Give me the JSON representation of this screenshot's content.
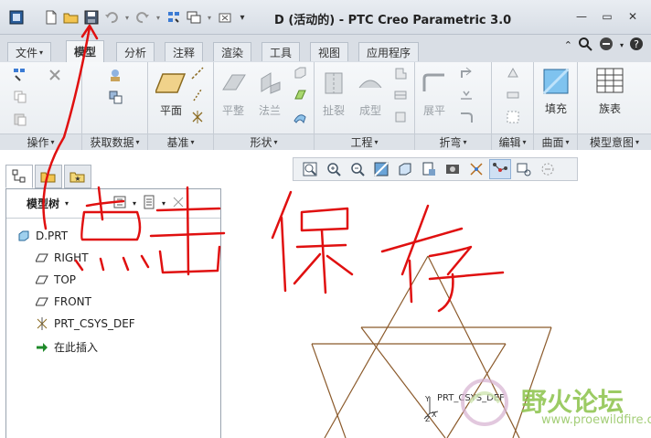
{
  "window": {
    "title": "D (活动的) - PTC Creo Parametric 3.0"
  },
  "ribbon_tabs": [
    {
      "label": "文件",
      "dropdown": "▾"
    },
    {
      "label": "模型"
    },
    {
      "label": "分析"
    },
    {
      "label": "注释"
    },
    {
      "label": "渲染"
    },
    {
      "label": "工具"
    },
    {
      "label": "视图"
    },
    {
      "label": "应用程序"
    }
  ],
  "ribbon": {
    "groups": [
      {
        "label": "操作"
      },
      {
        "label": "获取数据"
      },
      {
        "label": "基准"
      },
      {
        "label": "形状"
      },
      {
        "label": "工程"
      },
      {
        "label": "折弯"
      },
      {
        "label": "编辑"
      },
      {
        "label": "曲面"
      },
      {
        "label": "模型意图"
      }
    ],
    "buttons": {
      "plane": "平面",
      "flat": "平整",
      "flange": "法兰",
      "rip": "扯裂",
      "form": "成型",
      "unbend": "展平",
      "fill": "填充",
      "family_table": "族表"
    }
  },
  "model_tree": {
    "title": "模型树",
    "items": [
      {
        "label": "D.PRT",
        "icon": "part-icon"
      },
      {
        "label": "RIGHT",
        "icon": "datum-plane-icon"
      },
      {
        "label": "TOP",
        "icon": "datum-plane-icon"
      },
      {
        "label": "FRONT",
        "icon": "datum-plane-icon"
      },
      {
        "label": "PRT_CSYS_DEF",
        "icon": "csys-icon"
      },
      {
        "label": "在此插入",
        "icon": "insert-arrow-icon"
      }
    ]
  },
  "graphics": {
    "csys_label": "PRT_CSYS_DEF",
    "axis_x": "X",
    "axis_y": "Y",
    "axis_z": "Z"
  },
  "annotation": {
    "handwritten_text": "点击保存"
  },
  "watermark": {
    "text": "野火论坛",
    "url": "www.proewildfire.cn"
  },
  "colors": {
    "annotation": "#e01010",
    "sketch_lines": "#8b5a2b",
    "watermark": "#8bc34a"
  }
}
